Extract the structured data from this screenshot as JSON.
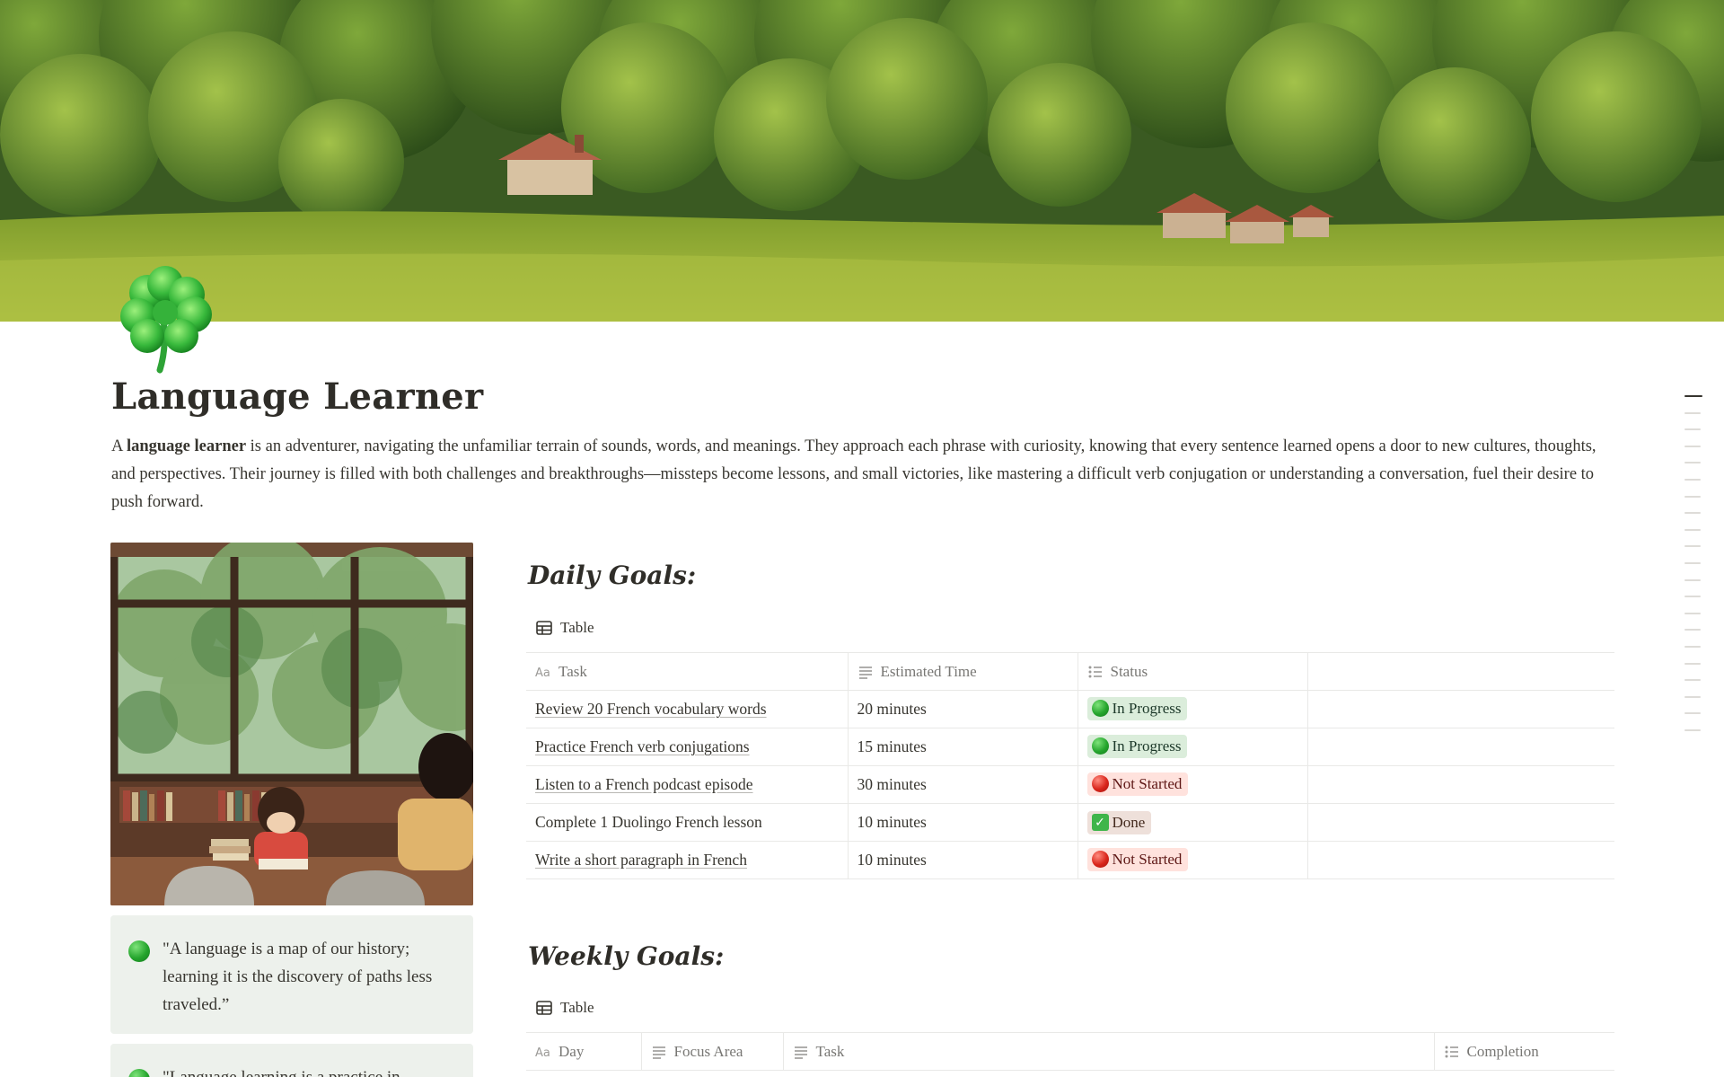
{
  "page": {
    "title": "Language Learner",
    "icon": "shamrock-icon",
    "cover": "countryside-landscape-cover"
  },
  "intro": {
    "prefix": "A ",
    "bold": "language learner",
    "rest": " is an adventurer, navigating the unfamiliar terrain of sounds, words, and meanings. They approach each phrase with curiosity, knowing that every sentence learned opens a door to new cultures, thoughts, and perspectives. Their journey is filled with both challenges and breakthroughs—missteps become lessons, and small victories, like mastering a difficult verb conjugation or understanding a conversation, fuel their desire to push forward."
  },
  "sidebar": {
    "image": "library-study-illustration",
    "quotes": [
      {
        "icon": "green-circle-icon",
        "text": "\"A language is a map of our history; learning it is the discovery of paths less traveled.”"
      },
      {
        "icon": "green-circle-icon",
        "text": "\"Language learning is a practice in"
      }
    ]
  },
  "daily": {
    "heading": "Daily Goals:",
    "view_label": "Table",
    "columns": [
      "Task",
      "Estimated Time",
      "Status"
    ],
    "rows": [
      {
        "task": "Review 20 French vocabulary words",
        "time": "20 minutes",
        "status": "In Progress",
        "status_icon": "green-circle-icon"
      },
      {
        "task": "Practice French verb conjugations",
        "time": "15 minutes",
        "status": "In Progress",
        "status_icon": "green-circle-icon"
      },
      {
        "task": "Listen to a French podcast episode",
        "time": "30 minutes",
        "status": "Not Started",
        "status_icon": "red-circle-icon"
      },
      {
        "task": "Complete 1 Duolingo French lesson",
        "time": "10 minutes",
        "status": "Done",
        "status_icon": "check-mark-icon"
      },
      {
        "task": "Write a short paragraph in French",
        "time": "10 minutes",
        "status": "Not Started",
        "status_icon": "red-circle-icon"
      }
    ]
  },
  "weekly": {
    "heading": "Weekly Goals:",
    "view_label": "Table",
    "columns": [
      "Day",
      "Focus Area",
      "Task",
      "Completion"
    ]
  },
  "colors": {
    "in_progress_bg": "#dbeddb",
    "not_started_bg": "#ffe2dd",
    "done_bg": "#eee0da",
    "callout_bg": "#edf1ec"
  }
}
